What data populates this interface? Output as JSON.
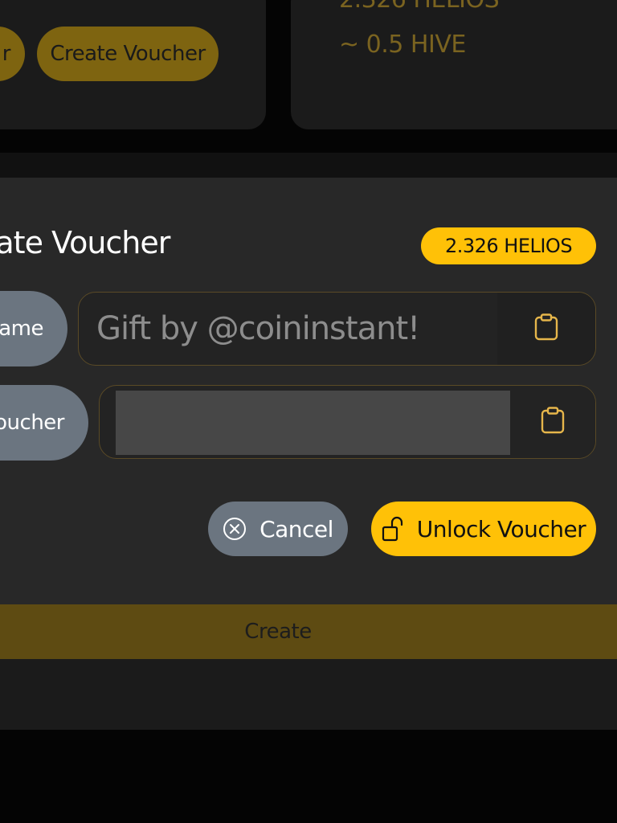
{
  "background": {
    "partial_button_label": "r",
    "create_voucher_label": "Create Voucher",
    "balance_partial": "2.326 HELIOS",
    "hive_estimate": "~ 0.5 HIVE"
  },
  "modal": {
    "title_partial": "eate Voucher",
    "balance_badge": "2.326 HELIOS",
    "name_label_partial": "ame",
    "name_placeholder": "Gift by @coininstant!",
    "voucher_label_partial": "oucher",
    "cancel_label": "Cancel",
    "unlock_label": "Unlock Voucher",
    "icons": {
      "paste": "clipboard-icon",
      "cancel": "circle-x-icon",
      "unlock": "unlock-icon"
    }
  },
  "create_bar_label": "Create",
  "colors": {
    "accent": "#ffc107",
    "accent_dim": "#7e6410",
    "neutral_button": "#6b7580",
    "modal_bg": "#282828"
  }
}
